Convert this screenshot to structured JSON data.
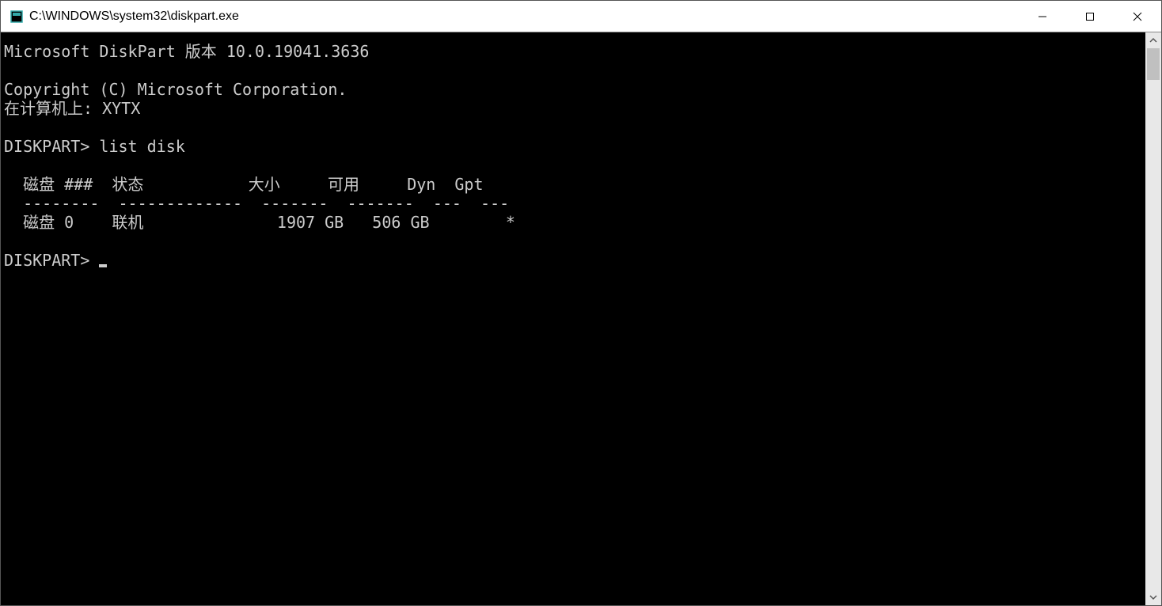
{
  "window": {
    "title": "C:\\WINDOWS\\system32\\diskpart.exe"
  },
  "console": {
    "version_line": "Microsoft DiskPart 版本 10.0.19041.3636",
    "copyright_line": "Copyright (C) Microsoft Corporation.",
    "computer_line": "在计算机上: XYTX",
    "prompt1": "DISKPART> list disk",
    "table": {
      "header": "  磁盘 ###  状态           大小     可用     Dyn  Gpt",
      "divider": "  --------  -------------  -------  -------  ---  ---",
      "row0": "  磁盘 0    联机              1907 GB   506 GB        *"
    },
    "prompt2": "DISKPART> "
  }
}
